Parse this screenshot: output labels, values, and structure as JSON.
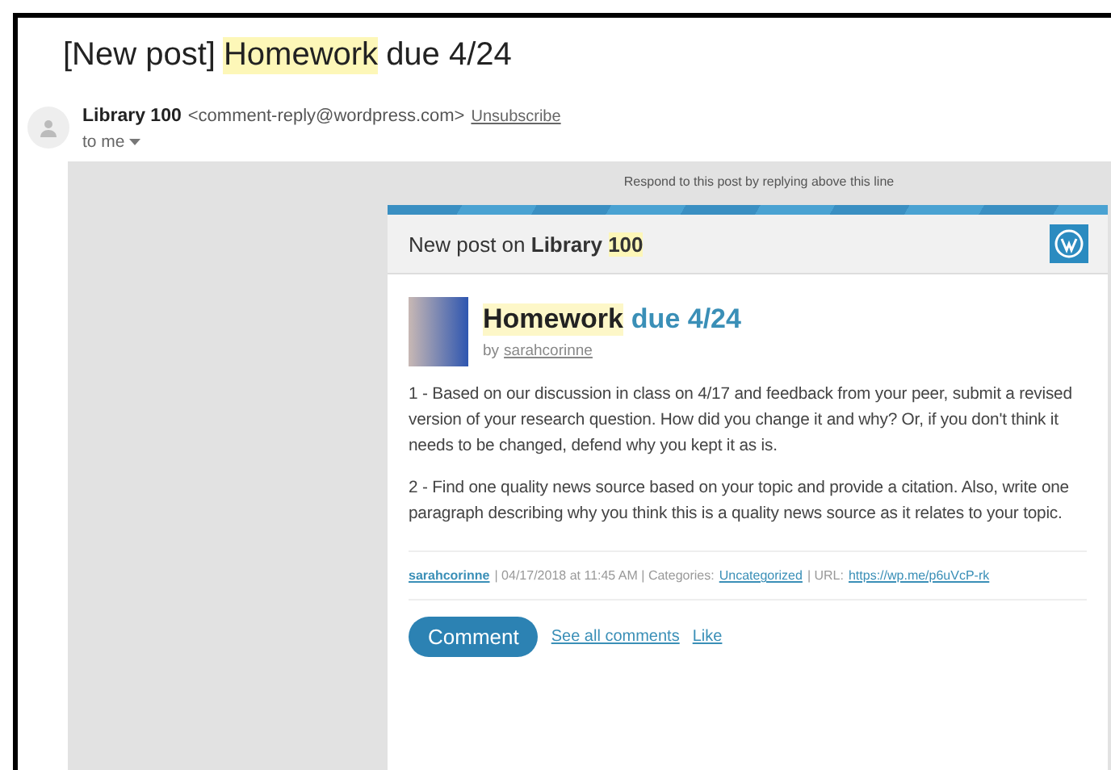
{
  "subject": {
    "prefix": "[New post]",
    "highlighted": "Homework",
    "suffix": "due 4/24"
  },
  "sender": {
    "name": "Library 100",
    "address": "<comment-reply@wordpress.com>",
    "unsubscribe": "Unsubscribe",
    "recipient": "to me"
  },
  "reply_notice": "Respond to this post by replying above this line",
  "card": {
    "header": "New post on **Library**",
    "header_highlight": "100",
    "post_title": {
      "highlighted": "Homework",
      "rest": "due 4/24"
    },
    "byline": "by",
    "author": "sarahcorinne",
    "paragraphs": [
      "1 - Based on our discussion in class on 4/17 and feedback from your peer, submit a revised version of your research question. How did you change it and why? Or, if you don't think it needs to be changed, defend why you kept it as is.",
      "2 - Find one quality news source based on your topic and provide a citation. Also, write one paragraph describing why you think this is a quality news source as it relates to your topic."
    ],
    "meta": {
      "author": "sarahcorinne",
      "date": "| 04/17/2018 at 11:45 AM | Categories:",
      "category": "Uncategorized",
      "url_label": "| URL:",
      "url": "https://wp.me/p6uVcP-rk"
    },
    "comment_button": "Comment",
    "links": [
      "See all comments",
      "Like"
    ]
  }
}
